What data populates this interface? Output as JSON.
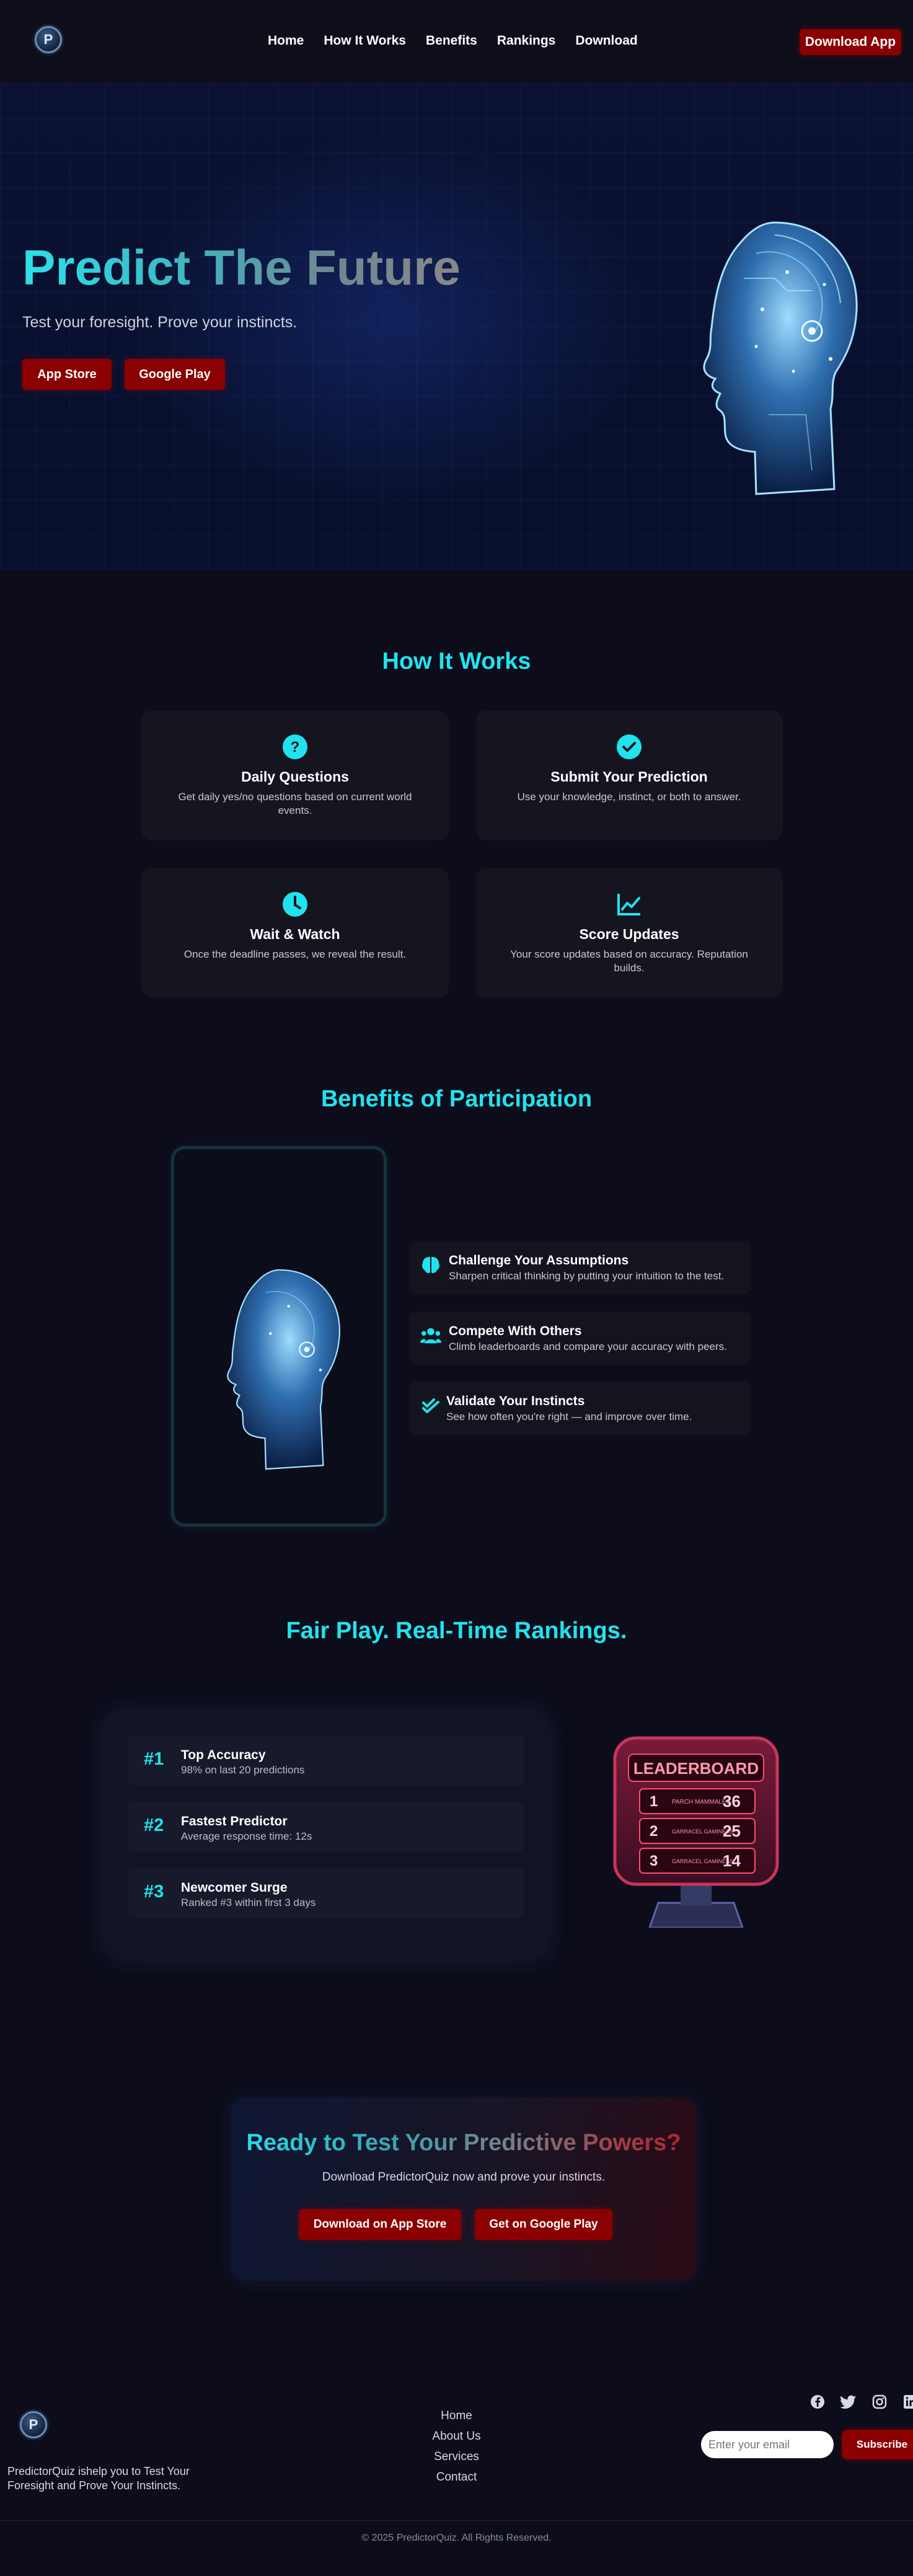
{
  "nav": {
    "logo_letter": "P",
    "links": [
      "Home",
      "How It Works",
      "Benefits",
      "Rankings",
      "Download"
    ],
    "download_label": "Download App"
  },
  "hero": {
    "title": "Predict The Future",
    "subtitle": "Test your foresight. Prove your instincts.",
    "app_store_label": "App Store",
    "google_play_label": "Google Play"
  },
  "how_it_works": {
    "title": "How It Works",
    "cards": [
      {
        "icon": "question-icon",
        "title": "Daily Questions",
        "desc": "Get daily yes/no questions based on current world events."
      },
      {
        "icon": "check-circle-icon",
        "title": "Submit Your Prediction",
        "desc": "Use your knowledge, instinct, or both to answer."
      },
      {
        "icon": "clock-icon",
        "title": "Wait & Watch",
        "desc": "Once the deadline passes, we reveal the result."
      },
      {
        "icon": "chart-line-icon",
        "title": "Score Updates",
        "desc": "Your score updates based on accuracy. Reputation builds."
      }
    ]
  },
  "benefits": {
    "title": "Benefits of Participation",
    "items": [
      {
        "icon": "brain-icon",
        "title": "Challenge Your Assumptions",
        "desc": "Sharpen critical thinking by putting your intuition to the test."
      },
      {
        "icon": "users-icon",
        "title": "Compete With Others",
        "desc": "Climb leaderboards and compare your accuracy with peers."
      },
      {
        "icon": "double-check-icon",
        "title": "Validate Your Instincts",
        "desc": "See how often you're right — and improve over time."
      }
    ]
  },
  "rankings": {
    "title": "Fair Play. Real-Time Rankings.",
    "rows": [
      {
        "rank": "#1",
        "title": "Top Accuracy",
        "desc": "98% on last 20 predictions"
      },
      {
        "rank": "#2",
        "title": "Fastest Predictor",
        "desc": "Average response time: 12s"
      },
      {
        "rank": "#3",
        "title": "Newcomer Surge",
        "desc": "Ranked #3 within first 3 days"
      }
    ],
    "leaderboard": {
      "heading": "LEADERBOARD",
      "rows": [
        {
          "pos": "1",
          "name": "PARCH MAMMALES",
          "score": "36"
        },
        {
          "pos": "2",
          "name": "GARRACEL GAMINESS",
          "score": "25"
        },
        {
          "pos": "3",
          "name": "GARRACEL GAMINESS",
          "score": "14"
        }
      ]
    }
  },
  "cta": {
    "title": "Ready to Test Your Predictive Powers?",
    "subtitle": "Download PredictorQuiz now and prove your instincts.",
    "app_store_label": "Download on App Store",
    "google_play_label": "Get on Google Play"
  },
  "footer": {
    "logo_letter": "P",
    "tagline": "PredictorQuiz ishelp you to Test Your Foresight and Prove Your Instincts.",
    "links": [
      "Home",
      "About Us",
      "Services",
      "Contact"
    ],
    "socials": [
      "facebook-icon",
      "twitter-icon",
      "instagram-icon",
      "linkedin-icon"
    ],
    "email_placeholder": "Enter your email",
    "subscribe_label": "Subscribe",
    "copyright": "© 2025 PredictorQuiz. All Rights Reserved."
  },
  "colors": {
    "accent": "#20e3ee",
    "brand_red": "#8b0000",
    "background": "#0c0c1a",
    "card": "#15151f"
  }
}
